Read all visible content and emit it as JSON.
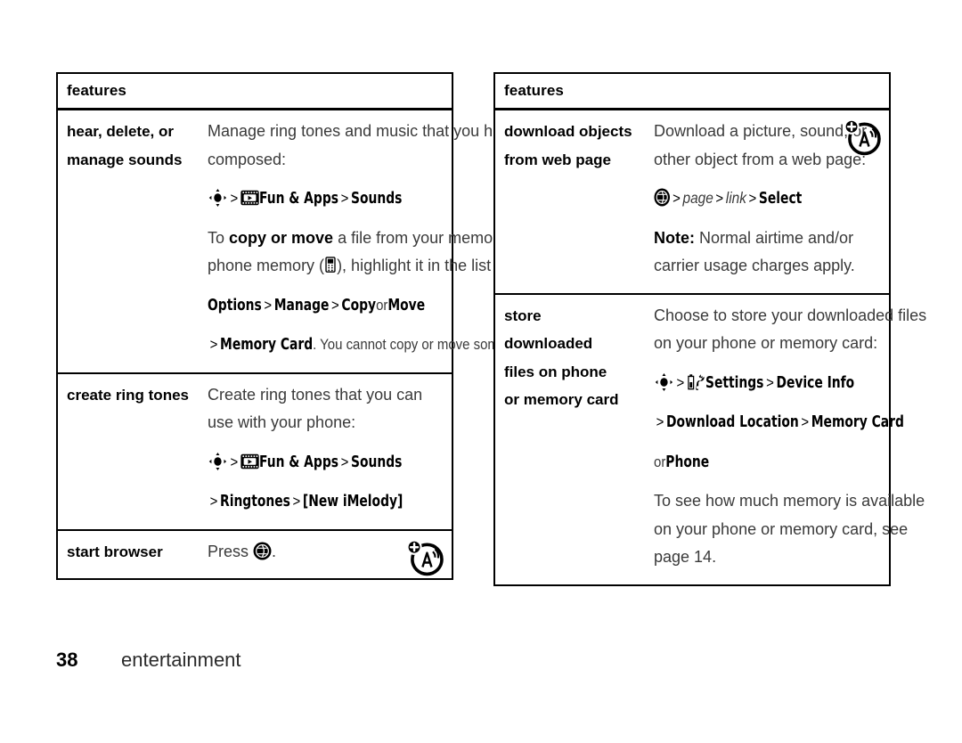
{
  "page": {
    "number": "38",
    "section": "entertainment"
  },
  "tables": [
    {
      "id": "left",
      "header": "features",
      "rows": [
        {
          "name_lines": [
            "hear, delete, or",
            "manage sounds"
          ],
          "corner_icon": "multimedia-phone-plus-icon",
          "blocks": [
            {
              "type": "text",
              "runs": [
                {
                  "t": "Manage ring tones and music that you have downloaded or composed:",
                  "style": "plain"
                }
              ]
            },
            {
              "type": "menupath",
              "runs": [
                {
                  "t": "",
                  "style": "icon",
                  "icon": "nav-key-icon"
                },
                {
                  "t": ">",
                  "style": "sep"
                },
                {
                  "t": "",
                  "style": "icon",
                  "icon": "fun-and-apps-icon"
                },
                {
                  "t": "Fun & Apps",
                  "style": "bold"
                },
                {
                  "t": ">",
                  "style": "sep"
                },
                {
                  "t": "Sounds",
                  "style": "bold"
                }
              ]
            },
            {
              "type": "text",
              "runs": [
                {
                  "t": "To ",
                  "style": "plain"
                },
                {
                  "t": "copy or move",
                  "style": "bold"
                },
                {
                  "t": " a file from your memory card (",
                  "style": "plain"
                },
                {
                  "t": "",
                  "style": "icon",
                  "icon": "memory-card-icon"
                },
                {
                  "t": ") to your phone memory (",
                  "style": "plain"
                },
                {
                  "t": "",
                  "style": "icon",
                  "icon": "phone-memory-icon"
                },
                {
                  "t": "), highlight it in the list and press",
                  "style": "plain"
                }
              ]
            },
            {
              "type": "menupath",
              "runs": [
                {
                  "t": "Options",
                  "style": "bold"
                },
                {
                  "t": ">",
                  "style": "sep"
                },
                {
                  "t": "Manage",
                  "style": "bold"
                },
                {
                  "t": ">",
                  "style": "sep"
                },
                {
                  "t": "Copy",
                  "style": "bold"
                },
                {
                  "t": "or",
                  "style": "plain"
                },
                {
                  "t": "Move",
                  "style": "bold"
                }
              ]
            },
            {
              "type": "menupath",
              "runs": [
                {
                  "t": ">",
                  "style": "sep"
                },
                {
                  "t": "Memory Card",
                  "style": "bold"
                },
                {
                  "t": ". You cannot copy or move some copyrighted files.",
                  "style": "plain"
                }
              ]
            }
          ]
        },
        {
          "name_lines": [
            "create ring tones"
          ],
          "corner_icon": null,
          "blocks": [
            {
              "type": "text",
              "runs": [
                {
                  "t": "Create ring tones that you can use with your phone:",
                  "style": "plain"
                }
              ]
            },
            {
              "type": "menupath",
              "runs": [
                {
                  "t": "",
                  "style": "icon",
                  "icon": "nav-key-icon"
                },
                {
                  "t": ">",
                  "style": "sep"
                },
                {
                  "t": "",
                  "style": "icon",
                  "icon": "fun-and-apps-icon"
                },
                {
                  "t": "Fun & Apps",
                  "style": "bold"
                },
                {
                  "t": ">",
                  "style": "sep"
                },
                {
                  "t": "Sounds",
                  "style": "bold"
                }
              ]
            },
            {
              "type": "menupath",
              "runs": [
                {
                  "t": ">",
                  "style": "sep"
                },
                {
                  "t": "Ringtones",
                  "style": "bold"
                },
                {
                  "t": ">",
                  "style": "sep"
                },
                {
                  "t": "[New iMelody]",
                  "style": "bold"
                }
              ]
            }
          ]
        },
        {
          "name_lines": [
            "start browser"
          ],
          "corner_icon": "browser-network-plus-icon",
          "blocks": [
            {
              "type": "text",
              "runs": [
                {
                  "t": "Press ",
                  "style": "plain"
                },
                {
                  "t": "",
                  "style": "icon",
                  "icon": "browser-key-icon"
                },
                {
                  "t": ".",
                  "style": "plain"
                }
              ]
            }
          ]
        }
      ]
    },
    {
      "id": "right",
      "header": "features",
      "rows": [
        {
          "name_lines": [
            "download objects",
            "from web page"
          ],
          "corner_icon": "browser-network-plus-icon",
          "blocks": [
            {
              "type": "text",
              "runs": [
                {
                  "t": "Download a picture, sound, or other object from a web page:",
                  "style": "plain"
                }
              ]
            },
            {
              "type": "menupath",
              "runs": [
                {
                  "t": "",
                  "style": "icon",
                  "icon": "browser-key-icon"
                },
                {
                  "t": ">",
                  "style": "sep"
                },
                {
                  "t": "page",
                  "style": "italic"
                },
                {
                  "t": ">",
                  "style": "sep"
                },
                {
                  "t": "link",
                  "style": "italic"
                },
                {
                  "t": ">",
                  "style": "sep"
                },
                {
                  "t": "Select",
                  "style": "bold"
                }
              ]
            },
            {
              "type": "text",
              "runs": [
                {
                  "t": "Note:",
                  "style": "bold"
                },
                {
                  "t": " Normal airtime and/or carrier usage charges apply.",
                  "style": "plain"
                }
              ]
            }
          ]
        },
        {
          "name_lines": [
            "store",
            "downloaded",
            "files on phone",
            "or memory card"
          ],
          "corner_icon": null,
          "blocks": [
            {
              "type": "text",
              "runs": [
                {
                  "t": "Choose to store your downloaded files on your phone or memory card:",
                  "style": "plain"
                }
              ]
            },
            {
              "type": "menupath",
              "runs": [
                {
                  "t": "",
                  "style": "icon",
                  "icon": "nav-key-icon"
                },
                {
                  "t": ">",
                  "style": "sep"
                },
                {
                  "t": "",
                  "style": "icon",
                  "icon": "settings-icon"
                },
                {
                  "t": "Settings",
                  "style": "bold"
                },
                {
                  "t": ">",
                  "style": "sep"
                },
                {
                  "t": "Device Info",
                  "style": "bold"
                }
              ]
            },
            {
              "type": "menupath",
              "runs": [
                {
                  "t": ">",
                  "style": "sep"
                },
                {
                  "t": "Download Location",
                  "style": "bold"
                },
                {
                  "t": ">",
                  "style": "sep"
                },
                {
                  "t": "Memory Card",
                  "style": "bold"
                }
              ]
            },
            {
              "type": "menupath",
              "runs": [
                {
                  "t": "or",
                  "style": "plain"
                },
                {
                  "t": "Phone",
                  "style": "bold"
                }
              ]
            },
            {
              "type": "text",
              "runs": [
                {
                  "t": "To see how much memory is available on your phone or memory card, see page 14.",
                  "style": "plain"
                }
              ]
            }
          ]
        }
      ]
    }
  ],
  "colors": {
    "ink": "#000000",
    "body_text": "#3a3a3a",
    "paper": "#ffffff"
  }
}
